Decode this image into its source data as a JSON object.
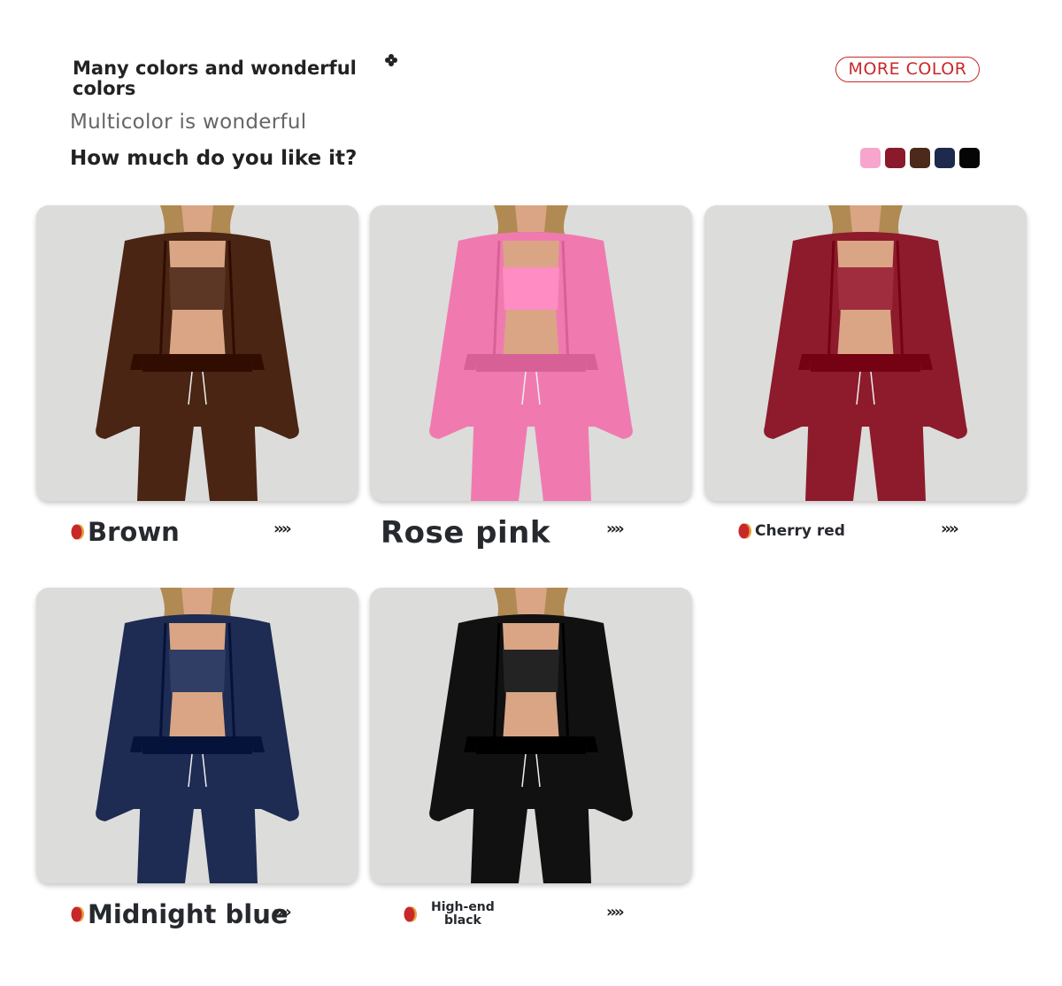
{
  "header": {
    "title": "Many colors and wonderful colors",
    "subtitle": "Multicolor is wonderful",
    "question": "How much do you like it?",
    "more_color_button": "MORE COLOR"
  },
  "swatches": [
    {
      "name": "pink",
      "color": "#f7a5cc"
    },
    {
      "name": "cherry-red",
      "color": "#8a1a2b"
    },
    {
      "name": "brown",
      "color": "#4b2a1b"
    },
    {
      "name": "navy",
      "color": "#1e2a4c"
    },
    {
      "name": "black",
      "color": "#050505"
    }
  ],
  "products": [
    {
      "label": "Brown",
      "color": "#4a2514",
      "arrows": "››››"
    },
    {
      "label": "Rose pink",
      "color": "#f07ab0",
      "arrows": "››››"
    },
    {
      "label": "Cherry red",
      "color": "#8d1b2b",
      "arrows": "››››"
    },
    {
      "label": "Midnight blue",
      "color": "#1e2b52",
      "arrows": "››››"
    },
    {
      "label": "High-end black",
      "label_line1": "High-end",
      "label_line2": "black",
      "color": "#111111",
      "arrows": "››››"
    }
  ],
  "accent_color": "#c8282a",
  "skin_color": "#d9a585",
  "hair_color": "#b08a52",
  "background_gray": "#dcdcdb"
}
